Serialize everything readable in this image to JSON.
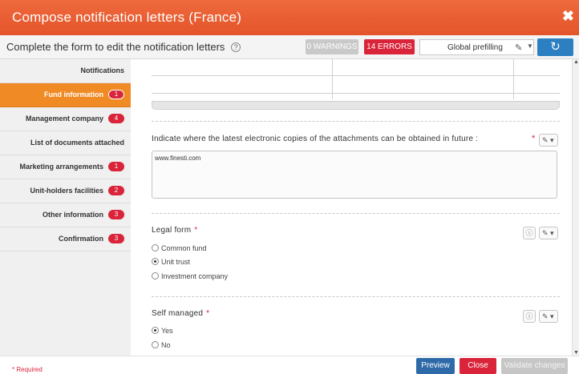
{
  "dialog": {
    "title": "Compose notification letters (France)",
    "close_glyph": "✖"
  },
  "header": {
    "subtitle": "Complete the form to edit the notification letters",
    "help_glyph": "?",
    "warnings_label": "0 WARNINGS",
    "errors_label": "14 ERRORS",
    "prefill_label": "Global prefilling",
    "refresh_glyph": "↻"
  },
  "sidebar": {
    "items": [
      {
        "label": "Notifications",
        "badge": ""
      },
      {
        "label": "Fund information",
        "badge": "1"
      },
      {
        "label": "Management company",
        "badge": "4"
      },
      {
        "label": "List of documents attached",
        "badge": ""
      },
      {
        "label": "Marketing arrangements",
        "badge": "1"
      },
      {
        "label": "Unit-holders facilities",
        "badge": "2"
      },
      {
        "label": "Other information",
        "badge": "3"
      },
      {
        "label": "Confirmation",
        "badge": "3"
      }
    ]
  },
  "form": {
    "attachments_question": "Indicate where the latest electronic copies of the attachments can be obtained in future :",
    "attachments_value": "www.finesti.com",
    "legal_form": {
      "label": "Legal form",
      "options": [
        "Common fund",
        "Unit trust",
        "Investment company"
      ],
      "selected": "Unit trust"
    },
    "self_managed": {
      "label": "Self managed",
      "options": [
        "Yes",
        "No"
      ],
      "selected": "Yes"
    },
    "required_star": "*"
  },
  "footer": {
    "required_note": "* Required",
    "preview_label": "Preview",
    "close_label": "Close",
    "validate_label": "Validate changes"
  },
  "colors": {
    "title_bar": "#e4542a",
    "active_nav": "#f08a24",
    "error_red": "#d9243a",
    "primary_blue": "#2f6aa8"
  }
}
